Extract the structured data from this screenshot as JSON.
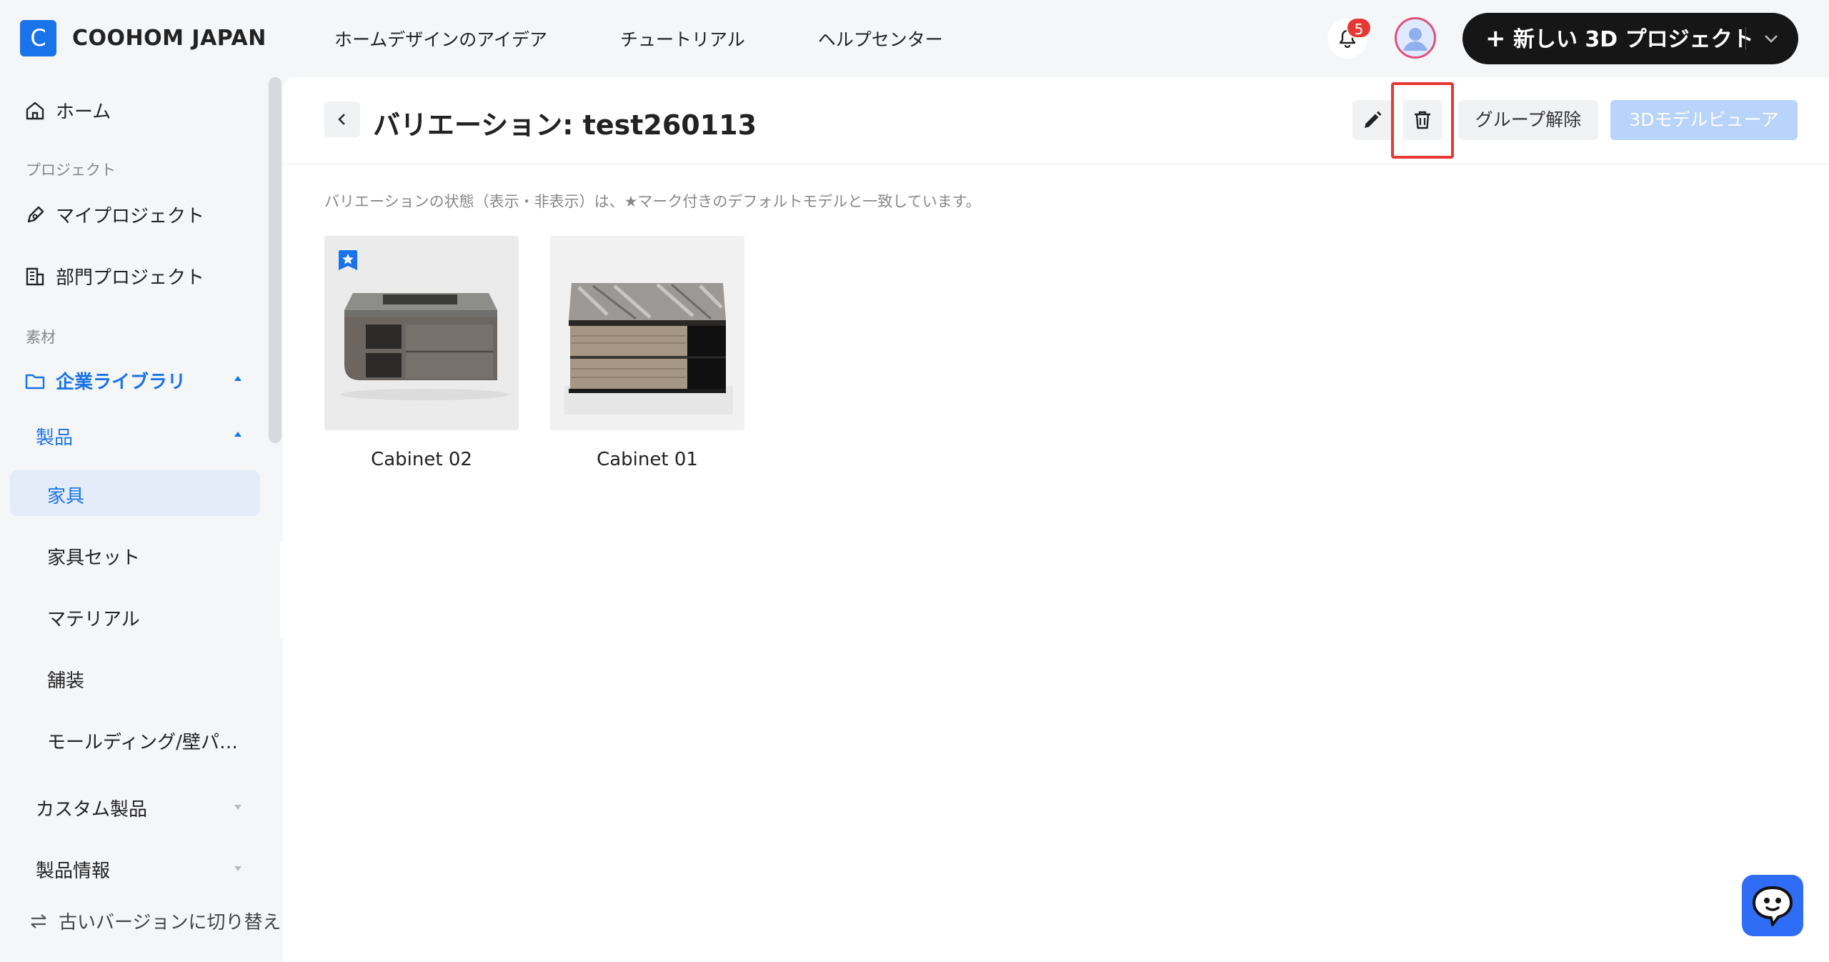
{
  "app": {
    "logo_letter": "C",
    "brand": "COOHOM JAPAN",
    "brand_color": "#1a73e8"
  },
  "topnav": {
    "items": [
      "ホームデザインのアイデア",
      "チュートリアル",
      "ヘルプセンター"
    ]
  },
  "header": {
    "notification_count": "5",
    "new_project_label": "新しい 3D プロジェクト"
  },
  "sidebar": {
    "home": "ホーム",
    "section_projects": "プロジェクト",
    "my_projects": "マイプロジェクト",
    "dept_projects": "部門プロジェクト",
    "section_materials": "素材",
    "enterprise_library": "企業ライブラリ",
    "products": "製品",
    "furniture": "家具",
    "furniture_sets": "家具セット",
    "materials": "マテリアル",
    "paving": "舗装",
    "molding": "モールディング/壁パ…",
    "custom_products": "カスタム製品",
    "product_info": "製品情報",
    "switch_old": "古いバージョンに切り替え"
  },
  "main": {
    "title": "バリエーション: test260113",
    "ungroup_label": "グループ解除",
    "viewer_label": "3Dモデルビューア",
    "notice": "バリエーションの状態（表示・非表示）は、★マーク付きのデフォルトモデルと一致しています。",
    "cards": [
      {
        "name": "Cabinet 02",
        "default": true
      },
      {
        "name": "Cabinet 01",
        "default": false
      }
    ]
  },
  "icons": {
    "edit": "pencil-icon",
    "delete": "trash-icon",
    "back": "chevron-left-icon",
    "bell": "bell-icon",
    "chat": "chat-icon"
  }
}
